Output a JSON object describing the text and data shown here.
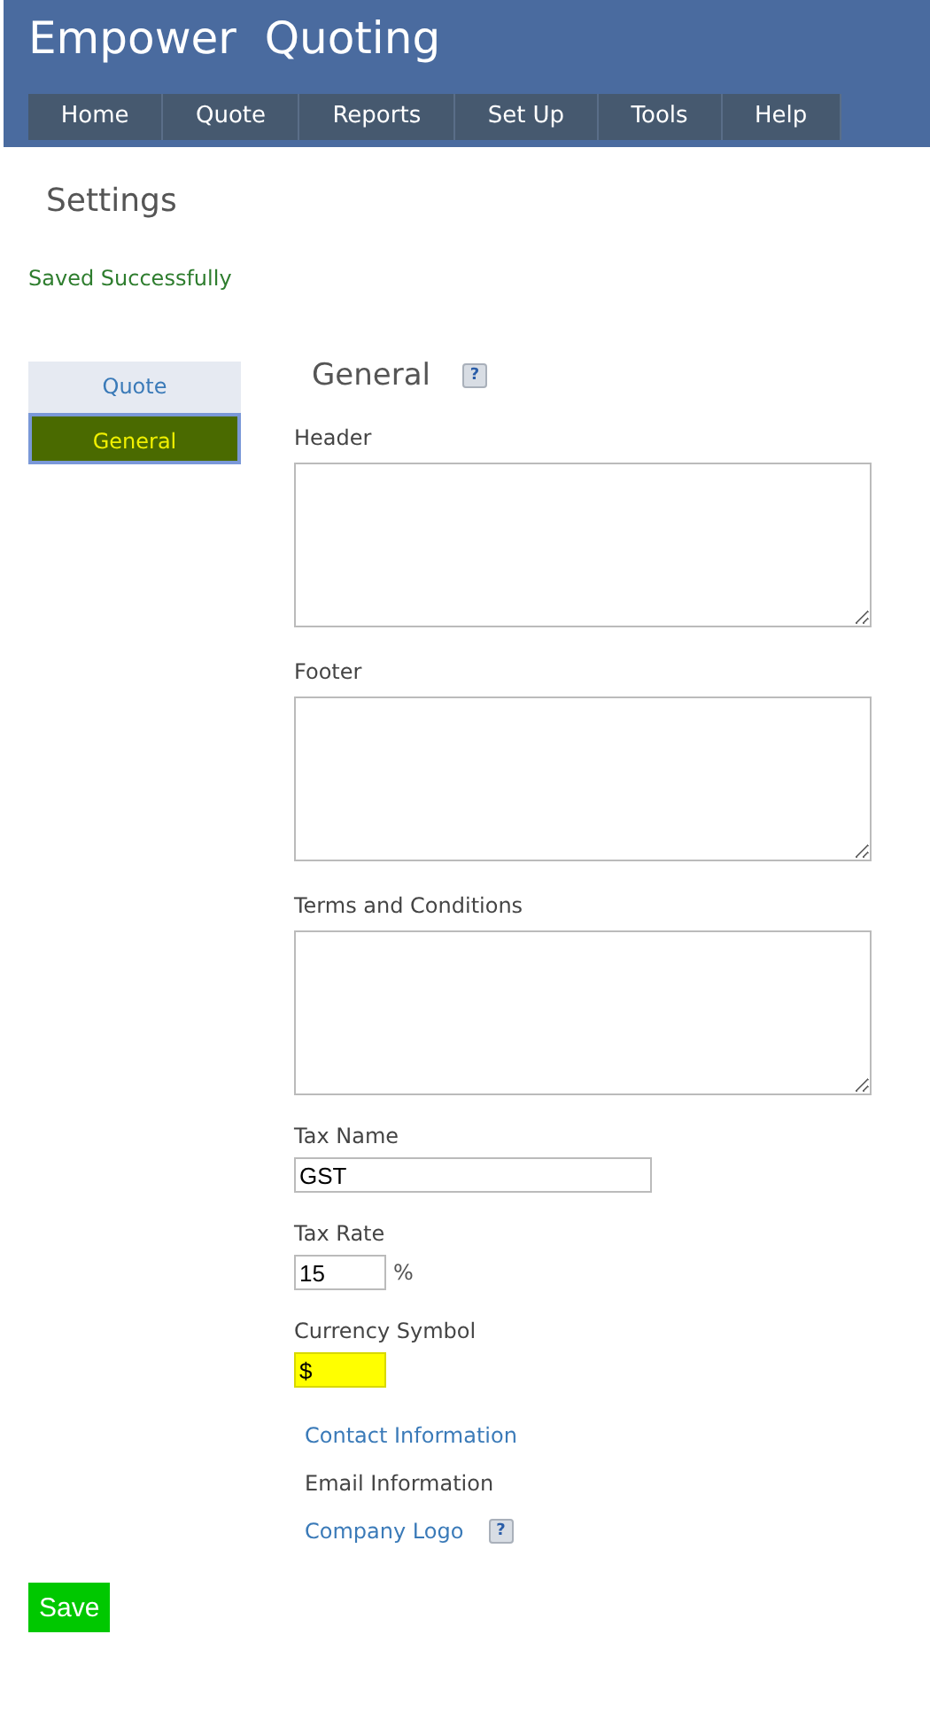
{
  "app_title": "Empower  Quoting",
  "nav": [
    {
      "label": "Home"
    },
    {
      "label": "Quote"
    },
    {
      "label": "Reports"
    },
    {
      "label": "Set Up"
    },
    {
      "label": "Tools"
    },
    {
      "label": "Help"
    }
  ],
  "page_title": "Settings",
  "status_message": "Saved Successfully",
  "side_tabs": [
    {
      "label": "Quote",
      "selected": false
    },
    {
      "label": "General",
      "selected": true
    }
  ],
  "section": {
    "title": "General",
    "help": "?"
  },
  "text_areas": [
    {
      "label": "Header"
    },
    {
      "label": "Footer"
    },
    {
      "label": "Terms and Conditions"
    }
  ],
  "fields": [
    {
      "label": "Tax Name",
      "value": "GST",
      "kind": "wide",
      "highlighted": false
    },
    {
      "label": "Tax Rate",
      "value": "15",
      "kind": "short",
      "suffix": "%",
      "highlighted": false
    },
    {
      "label": "Currency Symbol",
      "value": "$",
      "kind": "short",
      "highlighted": true
    }
  ],
  "links": [
    {
      "label": "Contact Information",
      "current": false
    },
    {
      "label": "Email Information",
      "current": true
    },
    {
      "label": "Company Logo",
      "current": false,
      "help": "?"
    }
  ],
  "save_button": "Save"
}
